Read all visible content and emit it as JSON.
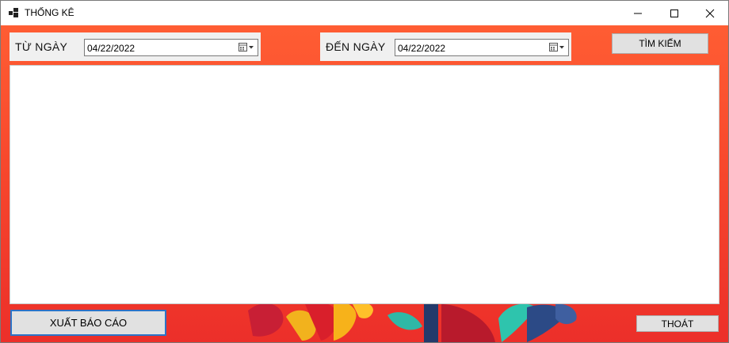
{
  "window": {
    "title": "THỐNG KÊ",
    "controls": [
      "minimize-icon",
      "maximize-icon",
      "close-icon"
    ]
  },
  "filter": {
    "from_label": "TỪ NGÀY",
    "from_value": "04/22/2022",
    "to_label": "ĐẾN NGÀY",
    "to_value": "04/22/2022",
    "search_label": "TÌM KIẾM"
  },
  "footer": {
    "export_label": "XUẤT BÁO CÁO",
    "exit_label": "THOÁT"
  },
  "colors": {
    "background_gradient_top": "#ff5d33",
    "background_gradient_bottom": "#ec2f2a",
    "button_face": "#e1e1e1",
    "focus_border": "#2b73c7"
  }
}
